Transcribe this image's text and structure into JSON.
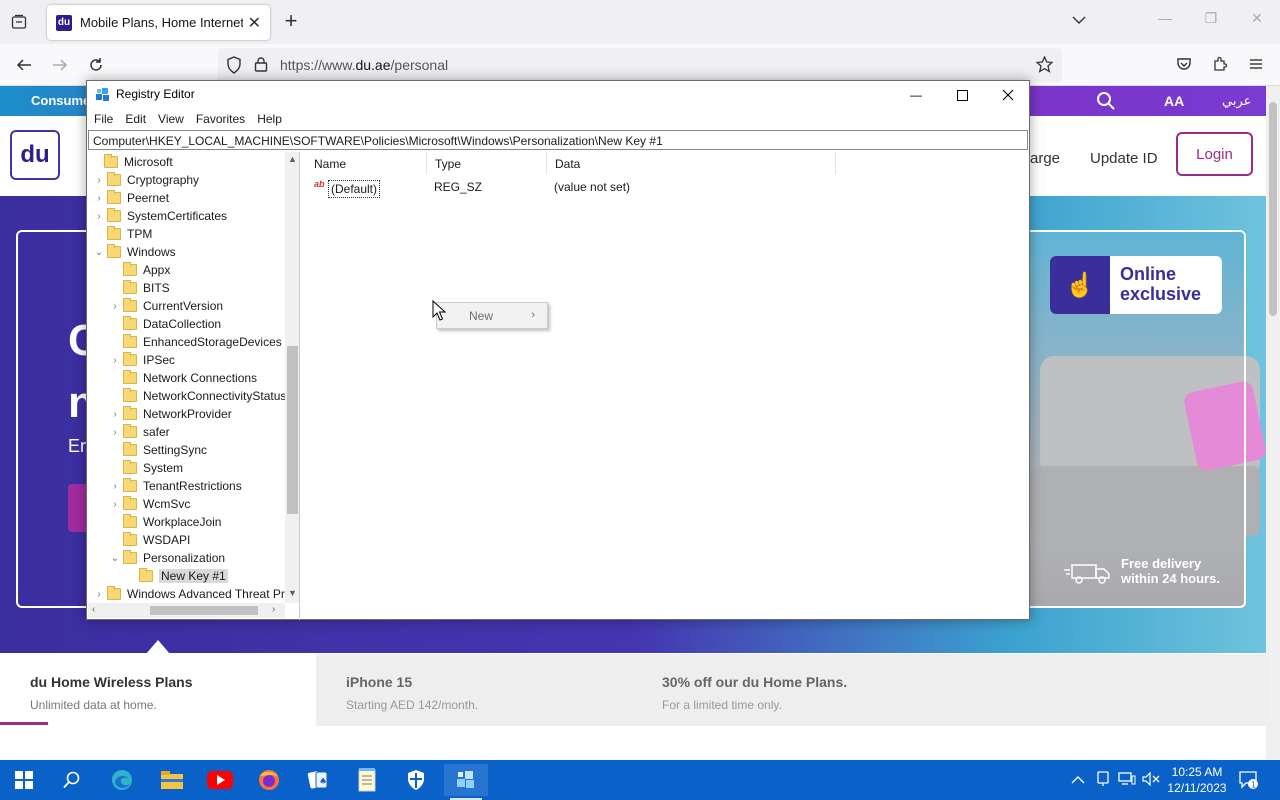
{
  "browser": {
    "tab_title": "Mobile Plans, Home Internet &",
    "url_prefix": "https://www.",
    "url_domain": "du.ae",
    "url_path": "/personal",
    "favicon_text": "du"
  },
  "site": {
    "consumer_label": "Consumer",
    "aa_label": "AA",
    "arabic_label": "عربي",
    "logo_text": "du",
    "nav_recharge": "arge",
    "nav_update": "Update ID",
    "login_label": "Login",
    "badge_line1": "Online",
    "badge_line2": "exclusive",
    "delivery_line1": "Free delivery",
    "delivery_line2": "within 24 hours.",
    "hero_fragment_1": "C",
    "hero_fragment_2": "n",
    "hero_fragment_3": "Er",
    "cards": [
      {
        "title": "du Home Wireless Plans",
        "subtitle": "Unlimited data at home."
      },
      {
        "title": "iPhone 15",
        "subtitle": "Starting AED 142/month."
      },
      {
        "title": "30% off our du Home Plans.",
        "subtitle": "For a limited time only."
      }
    ]
  },
  "regedit": {
    "title": "Registry Editor",
    "menu": [
      "File",
      "Edit",
      "View",
      "Favorites",
      "Help"
    ],
    "address": "Computer\\HKEY_LOCAL_MACHINE\\SOFTWARE\\Policies\\Microsoft\\Windows\\Personalization\\New Key #1",
    "tree": [
      {
        "label": "Microsoft",
        "level": 0,
        "expander": "",
        "selected": false
      },
      {
        "label": "Cryptography",
        "level": 1,
        "expander": "›",
        "selected": false
      },
      {
        "label": "Peernet",
        "level": 1,
        "expander": "›",
        "selected": false
      },
      {
        "label": "SystemCertificates",
        "level": 1,
        "expander": "›",
        "selected": false
      },
      {
        "label": "TPM",
        "level": 1,
        "expander": "",
        "selected": false
      },
      {
        "label": "Windows",
        "level": 1,
        "expander": "⌄",
        "selected": false
      },
      {
        "label": "Appx",
        "level": 2,
        "expander": "",
        "selected": false
      },
      {
        "label": "BITS",
        "level": 2,
        "expander": "",
        "selected": false
      },
      {
        "label": "CurrentVersion",
        "level": 2,
        "expander": "›",
        "selected": false
      },
      {
        "label": "DataCollection",
        "level": 2,
        "expander": "",
        "selected": false
      },
      {
        "label": "EnhancedStorageDevices",
        "level": 2,
        "expander": "",
        "selected": false
      },
      {
        "label": "IPSec",
        "level": 2,
        "expander": "›",
        "selected": false
      },
      {
        "label": "Network Connections",
        "level": 2,
        "expander": "",
        "selected": false
      },
      {
        "label": "NetworkConnectivityStatusI",
        "level": 2,
        "expander": "",
        "selected": false
      },
      {
        "label": "NetworkProvider",
        "level": 2,
        "expander": "›",
        "selected": false
      },
      {
        "label": "safer",
        "level": 2,
        "expander": "›",
        "selected": false
      },
      {
        "label": "SettingSync",
        "level": 2,
        "expander": "",
        "selected": false
      },
      {
        "label": "System",
        "level": 2,
        "expander": "",
        "selected": false
      },
      {
        "label": "TenantRestrictions",
        "level": 2,
        "expander": "›",
        "selected": false
      },
      {
        "label": "WcmSvc",
        "level": 2,
        "expander": "›",
        "selected": false
      },
      {
        "label": "WorkplaceJoin",
        "level": 2,
        "expander": "",
        "selected": false
      },
      {
        "label": "WSDAPI",
        "level": 2,
        "expander": "",
        "selected": false
      },
      {
        "label": "Personalization",
        "level": 2,
        "expander": "⌄",
        "selected": false
      },
      {
        "label": "New Key #1",
        "level": 3,
        "expander": "",
        "selected": true
      },
      {
        "label": "Windows Advanced Threat Pro",
        "level": 1,
        "expander": "›",
        "selected": false
      }
    ],
    "columns": [
      "Name",
      "Type",
      "Data"
    ],
    "values": [
      {
        "name": "(Default)",
        "type": "REG_SZ",
        "data": "(value not set)",
        "icon": "ab"
      }
    ],
    "context_menu": {
      "label": "New",
      "arrow": "›"
    }
  },
  "taskbar": {
    "time": "10:25 AM",
    "date": "12/11/2023",
    "notification_count": "1",
    "apps": [
      "start-icon",
      "search-icon",
      "edge-icon",
      "file-explorer-icon",
      "youtube-icon",
      "firefox-icon",
      "solitaire-icon",
      "notepad-icon",
      "defender-icon",
      "registry-editor-icon"
    ]
  },
  "colors": {
    "taskbar": "#0a62c9",
    "du_purple": "#3b2e9e",
    "login_accent": "#9b2c88",
    "folder": "#f8d775"
  }
}
